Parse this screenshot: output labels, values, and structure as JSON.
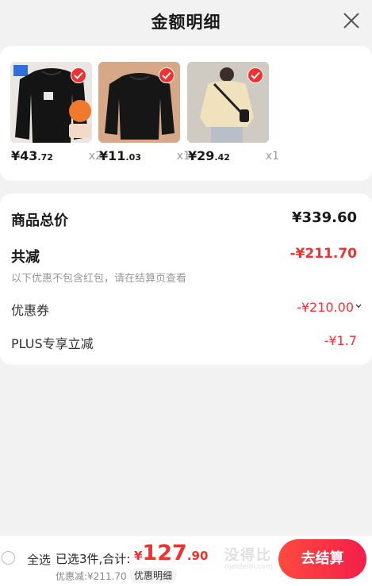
{
  "header": {
    "title": "金额明细"
  },
  "products": [
    {
      "price_symbol": "¥",
      "price_int": "43",
      "price_dec": ".72",
      "qty": "x2"
    },
    {
      "price_symbol": "¥",
      "price_int": "11",
      "price_dec": ".03",
      "qty": "x1"
    },
    {
      "price_symbol": "¥",
      "price_int": "29",
      "price_dec": ".42",
      "qty": "x1"
    }
  ],
  "summary": {
    "total_label": "商品总价",
    "total_value": "¥339.60",
    "reduce_label": "共减",
    "reduce_value": "-¥211.70",
    "reduce_note": "以下优惠不包含红包，请在结算页查看",
    "coupon_label": "优惠券",
    "coupon_value": "-¥210.00",
    "plus_label": "PLUS专享立减",
    "plus_value": "-¥1.7"
  },
  "bottom": {
    "select_all": "全选",
    "selected_text": "已选3件,合计:",
    "total_symbol": "¥",
    "total_int": "127",
    "total_dec": ".90",
    "discount_text": "优惠减:¥211.70",
    "detail_link": "优惠明细",
    "checkout_label": "去结算",
    "watermark_text": "没得比",
    "watermark_url": "meideibi.com"
  },
  "colors": {
    "accent": "#f23030",
    "checkout_gradient_start": "#ff4a3e",
    "checkout_gradient_end": "#f41e4a"
  }
}
